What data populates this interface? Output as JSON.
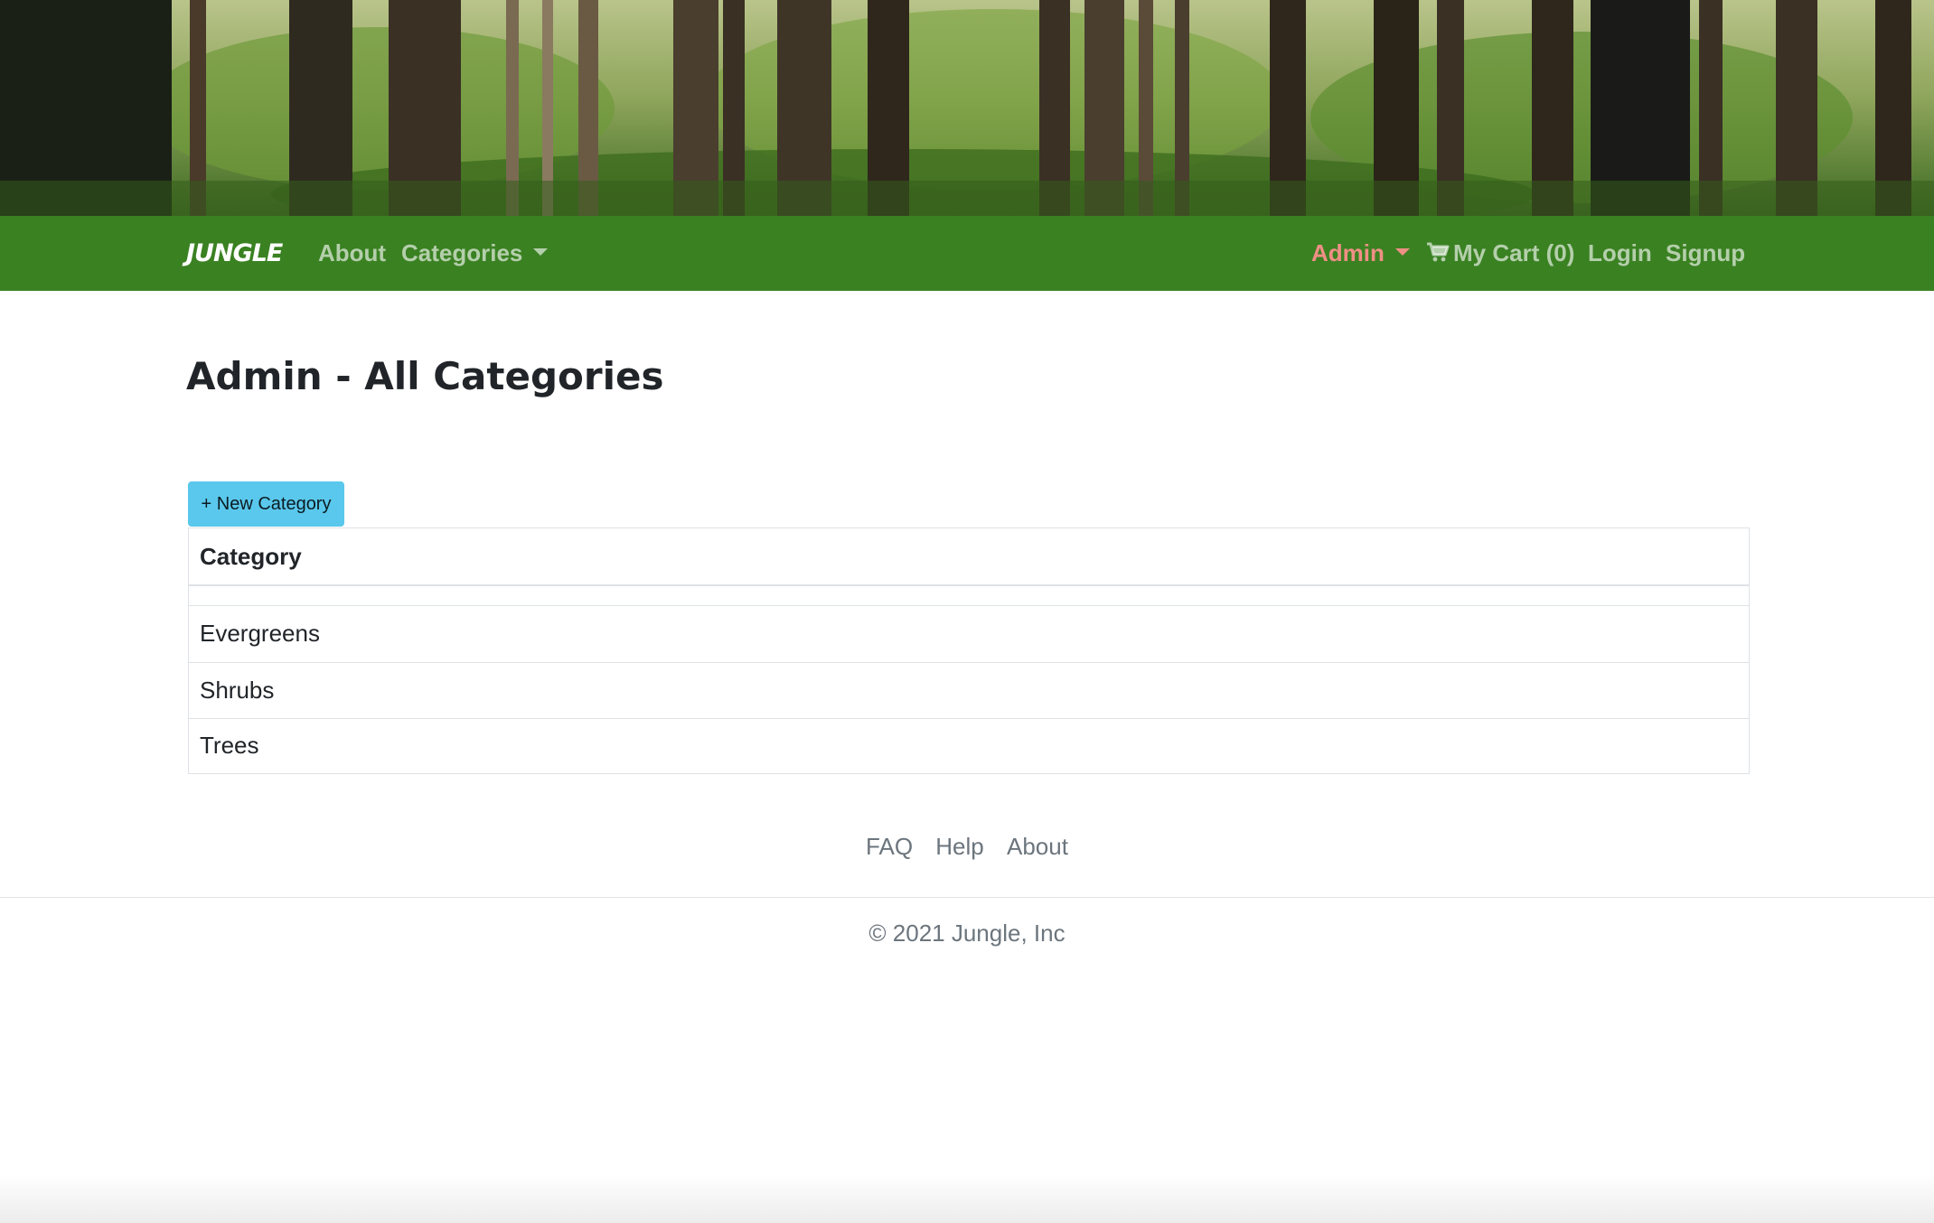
{
  "navbar": {
    "brand": "JUNGLE",
    "about": "About",
    "categories": "Categories",
    "admin": "Admin",
    "cart": "My Cart (0)",
    "login": "Login",
    "signup": "Signup"
  },
  "main": {
    "title": "Admin - All Categories",
    "new_button": "+ New Category",
    "table": {
      "header": "Category",
      "rows": [
        "Evergreens",
        "Shrubs",
        "Trees"
      ]
    }
  },
  "footer": {
    "links": [
      "FAQ",
      "Help",
      "About"
    ],
    "copyright": "© 2021 Jungle, Inc"
  },
  "colors": {
    "navbar": "#3a8122",
    "admin_link": "#f08f85",
    "button": "#5ac8ec"
  },
  "icons": {
    "cart": "shopping-cart-icon",
    "dropdown": "caret-down-icon"
  }
}
